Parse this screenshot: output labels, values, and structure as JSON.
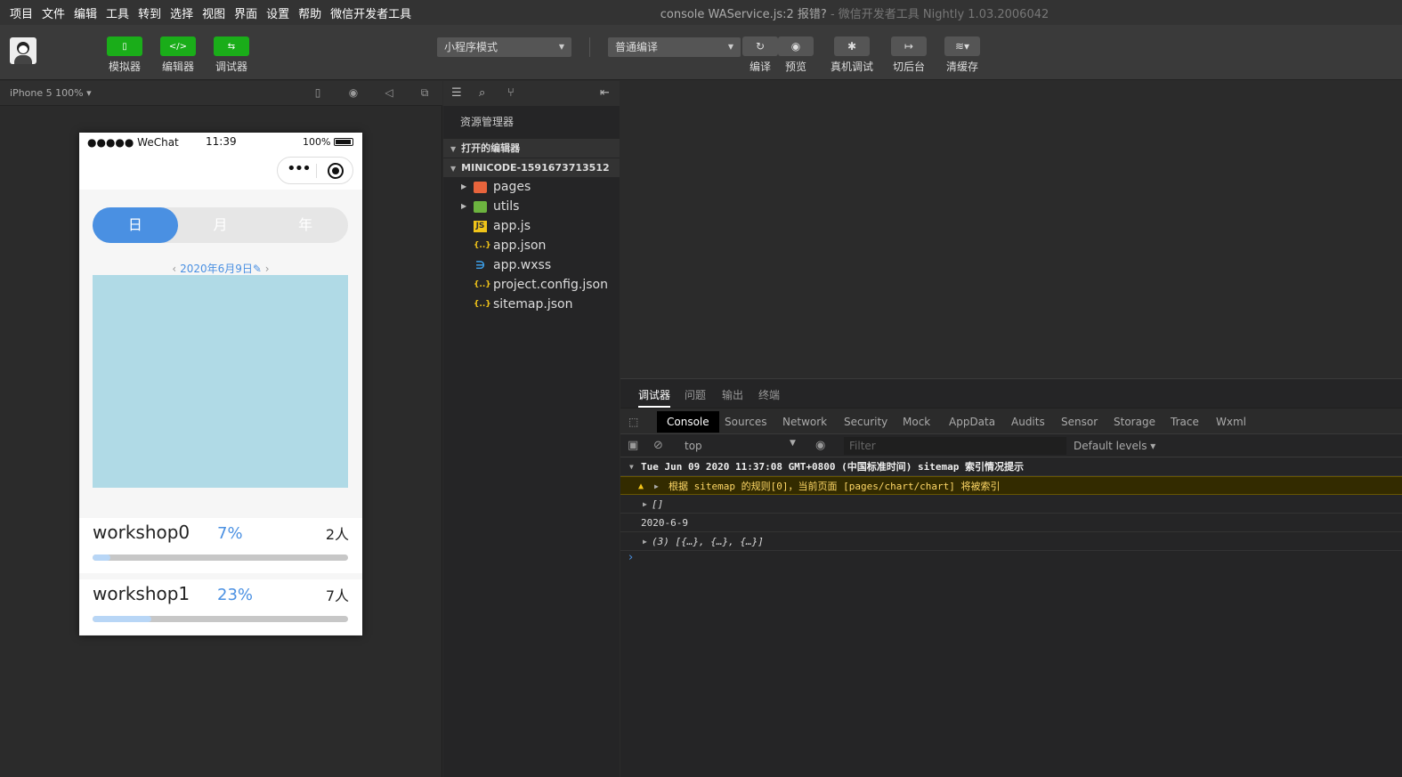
{
  "menu": [
    "项目",
    "文件",
    "编辑",
    "工具",
    "转到",
    "选择",
    "视图",
    "界面",
    "设置",
    "帮助",
    "微信开发者工具"
  ],
  "window_title": "console WAService.js:2 报错?",
  "window_subtitle": "- 微信开发者工具 Nightly 1.03.2006042",
  "toolbar": {
    "simulator": "模拟器",
    "editor": "编辑器",
    "debugger": "调试器",
    "mode_select": "小程序模式",
    "compile_select": "普通编译",
    "compile": "编译",
    "preview": "预览",
    "real_debug": "真机调试",
    "background": "切后台",
    "clear_cache": "清缓存"
  },
  "device": "iPhone 5 100% ▾",
  "phone": {
    "signal": "●●●●● WeChat",
    "time": "11:39",
    "battery": "100%",
    "tabs": [
      "日",
      "月",
      "年"
    ],
    "date": "2020年6月9日",
    "workshops": [
      {
        "name": "workshop0",
        "percent": "7%",
        "count": "2人",
        "progress": 0.07
      },
      {
        "name": "workshop1",
        "percent": "23%",
        "count": "7人",
        "progress": 0.23
      }
    ]
  },
  "explorer": {
    "header": "资源管理器",
    "open_editors": "打开的编辑器",
    "project": "MINICODE-1591673713512",
    "folders": [
      "pages",
      "utils"
    ],
    "files": [
      "app.js",
      "app.json",
      "app.wxss",
      "project.config.json",
      "sitemap.json"
    ]
  },
  "devtools": {
    "top_tabs": [
      "调试器",
      "问题",
      "输出",
      "终端"
    ],
    "panels": [
      "Console",
      "Sources",
      "Network",
      "Security",
      "Mock",
      "AppData",
      "Audits",
      "Sensor",
      "Storage",
      "Trace",
      "Wxml"
    ],
    "context": "top",
    "filter_placeholder": "Filter",
    "levels": "Default levels ▾",
    "group_title": "Tue Jun 09 2020 11:37:08 GMT+0800 (中国标准时间) sitemap 索引情况提示",
    "warning": "根据 sitemap 的规则[0]，当前页面 [pages/chart/chart] 将被索引",
    "log1": "[]",
    "log2": "2020-6-9",
    "log3": "(3) [{…}, {…}, {…}]"
  }
}
